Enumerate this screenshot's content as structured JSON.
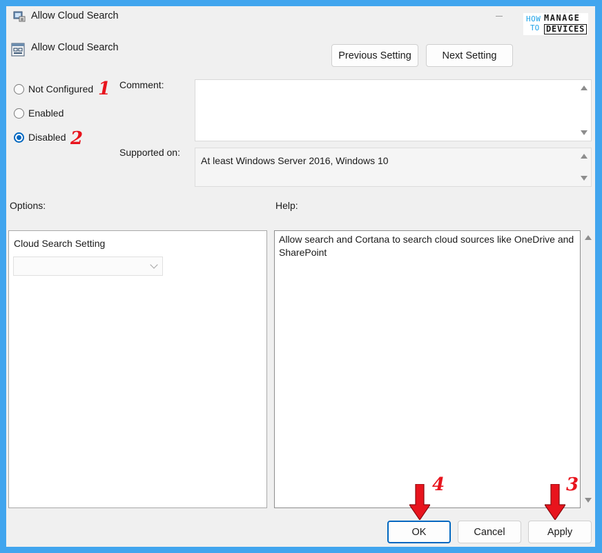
{
  "window": {
    "title": "Allow Cloud Search"
  },
  "logo": {
    "how": "HOW",
    "to": "TO",
    "manage": "MANAGE",
    "devices": "DEVICES"
  },
  "policy": {
    "title": "Allow Cloud Search"
  },
  "nav": {
    "previous_label": "Previous Setting",
    "next_label": "Next Setting"
  },
  "state": {
    "options": [
      {
        "label": "Not Configured",
        "checked": false
      },
      {
        "label": "Enabled",
        "checked": false
      },
      {
        "label": "Disabled",
        "checked": true
      }
    ]
  },
  "fields": {
    "comment_label": "Comment:",
    "comment_value": "",
    "supported_label": "Supported on:",
    "supported_value": "At least Windows Server 2016, Windows 10"
  },
  "sections": {
    "options_label": "Options:",
    "help_label": "Help:"
  },
  "options_panel": {
    "setting_label": "Cloud Search Setting",
    "dropdown_value": ""
  },
  "help": {
    "text": "Allow search and Cortana to search cloud sources like OneDrive and SharePoint"
  },
  "footer": {
    "ok_label": "OK",
    "cancel_label": "Cancel",
    "apply_label": "Apply"
  },
  "annotations": {
    "one": "1",
    "two": "2",
    "three": "3",
    "four": "4"
  },
  "colors": {
    "background": "#41a5ee",
    "dialog": "#f0f0f0",
    "accent": "#0067c0",
    "annotation": "#e8141d"
  }
}
